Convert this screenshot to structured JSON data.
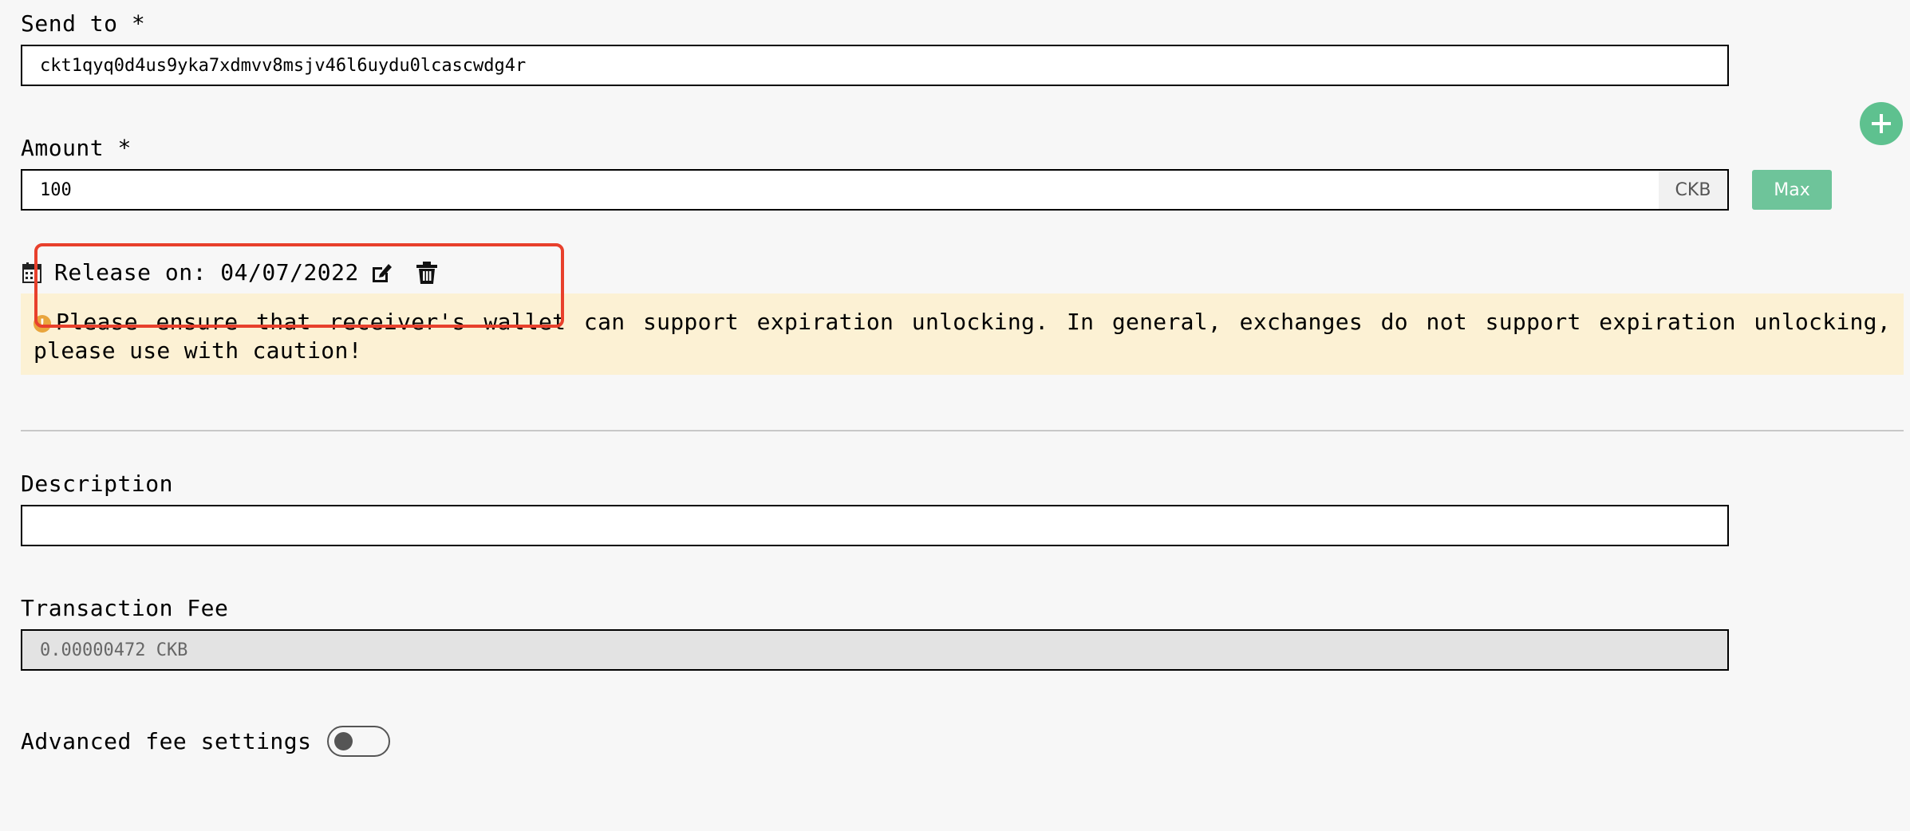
{
  "send_to": {
    "label": "Send to *",
    "value": "ckt1qyq0d4us9yka7xdmvv8msjv46l6uydu0lcascwdg4r"
  },
  "amount": {
    "label": "Amount *",
    "value": "100",
    "unit": "CKB",
    "max_label": "Max"
  },
  "release": {
    "label": "Release on:",
    "date": "04/07/2022",
    "icons": [
      "calendar-icon",
      "edit-icon",
      "trash-icon"
    ]
  },
  "warning": {
    "icon_text": "!",
    "text": "Please ensure that receiver's wallet can support expiration unlocking. In general, exchanges do not support expiration unlocking, please use with caution!"
  },
  "description": {
    "label": "Description",
    "value": ""
  },
  "transaction_fee": {
    "label": "Transaction Fee",
    "value": "0.00000472 CKB"
  },
  "advanced_fee": {
    "label": "Advanced fee settings",
    "enabled": false
  },
  "colors": {
    "accent_green": "#5ec18f",
    "max_button": "#6ec49a",
    "warning_bg": "#fcf1d4",
    "warning_icon": "#e9a53c",
    "highlight_red": "#e8402c"
  }
}
